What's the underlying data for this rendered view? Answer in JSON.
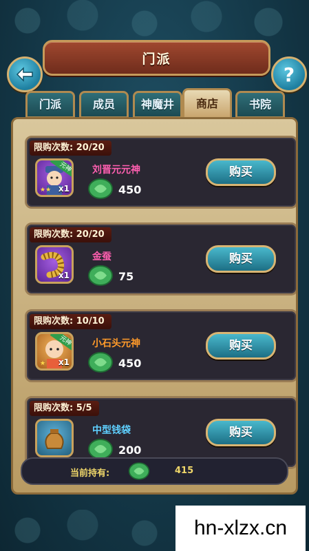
{
  "header": {
    "title": "门派"
  },
  "tabs": [
    {
      "label": "门派",
      "active": false
    },
    {
      "label": "成员",
      "active": false
    },
    {
      "label": "神魔井",
      "active": false
    },
    {
      "label": "商店",
      "active": true
    },
    {
      "label": "书院",
      "active": false
    }
  ],
  "shop": {
    "items": [
      {
        "limit_label": "限购次数:",
        "limit_value": "20/20",
        "name": "刘晋元元神",
        "name_color": "#ff5fb0",
        "qty": "x1",
        "ribbon": "元神",
        "stars": "★★",
        "price": "450",
        "buy_label": "购买",
        "icon": "hero-liu-jinyuan-icon"
      },
      {
        "limit_label": "限购次数:",
        "limit_value": "20/20",
        "name": "金蚕",
        "name_color": "#ff5fb0",
        "qty": "x1",
        "ribbon": "",
        "stars": "",
        "price": "75",
        "buy_label": "购买",
        "icon": "golden-silkworm-icon"
      },
      {
        "limit_label": "限购次数:",
        "limit_value": "10/10",
        "name": "小石头元神",
        "name_color": "#ff9a2a",
        "qty": "x1",
        "ribbon": "元神",
        "stars": "★",
        "price": "450",
        "buy_label": "购买",
        "icon": "hero-xiao-shitou-icon"
      },
      {
        "limit_label": "限购次数:",
        "limit_value": "5/5",
        "name": "中型钱袋",
        "name_color": "#5fd0ff",
        "qty": "",
        "ribbon": "",
        "stars": "",
        "price": "200",
        "buy_label": "购买",
        "icon": "money-bag-icon"
      }
    ]
  },
  "footer": {
    "holding_label": "当前持有:",
    "holding_value": "415",
    "currency_icon": "jade-coin-icon"
  },
  "watermark": "hn-xlzx.cn"
}
